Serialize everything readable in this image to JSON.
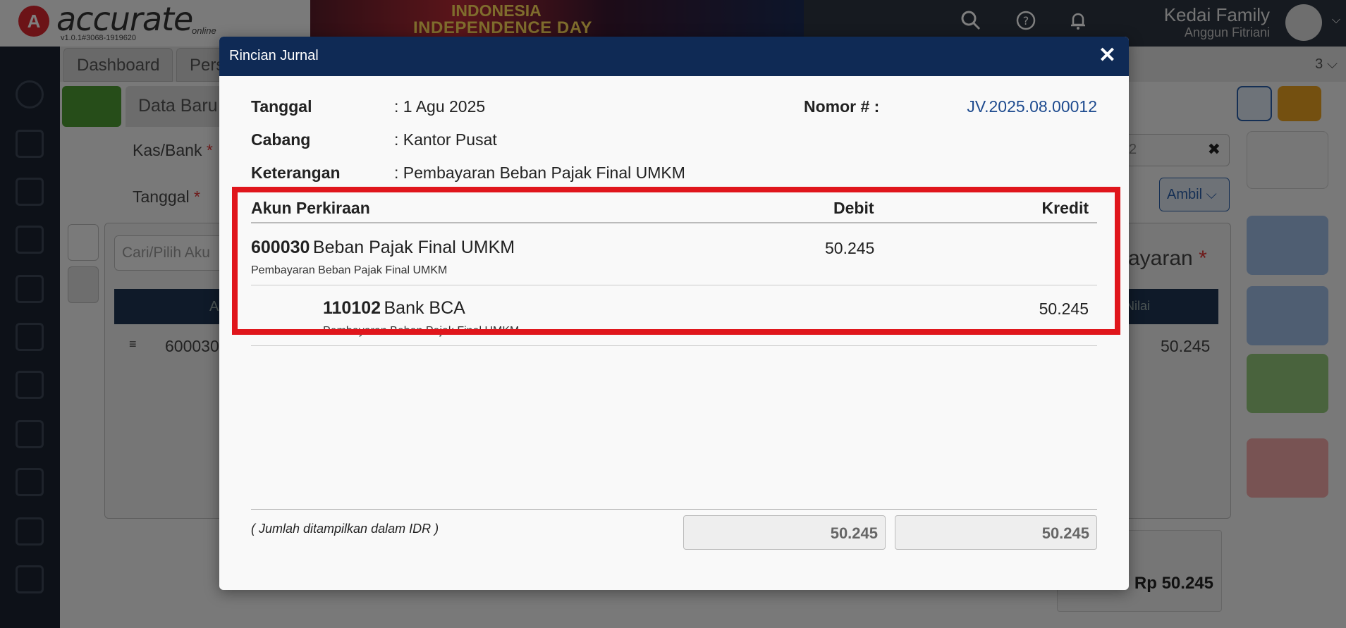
{
  "app": {
    "logo_text": "accurate",
    "logo_sub": "online",
    "version": "v1.0.1#3068-1919620",
    "banner_line1": "INDONESIA",
    "banner_line2": "INDEPENDENCE DAY",
    "company": "Kedai Family",
    "user": "Anggun Fitriani",
    "tabs": [
      "Dashboard",
      "Pers"
    ],
    "tab_count": "3 ⌵",
    "subtab": "Data Baru",
    "form_kas_bank": "Kas/Bank",
    "form_tanggal": "Tanggal",
    "search_placeholder": "Cari/Pilih Aku",
    "row_code": "600030",
    "col_a": "A",
    "col_nilai": "Nilai",
    "row_value": "50.245",
    "ambil_label": "Ambil",
    "section_label": "ayaran",
    "total": "Rp 50.245",
    "fragment_2": "2"
  },
  "modal": {
    "title": "Rincian Jurnal",
    "close_icon": "✕",
    "tanggal_label": "Tanggal",
    "tanggal_value": ": 1 Agu 2025",
    "cabang_label": "Cabang",
    "cabang_value": ": Kantor Pusat",
    "keterangan_label": "Keterangan",
    "keterangan_value": ": Pembayaran Beban Pajak Final UMKM",
    "nomor_label": "Nomor # :",
    "nomor_value": "JV.2025.08.00012",
    "table": {
      "headers": {
        "akun": "Akun Perkiraan",
        "debit": "Debit",
        "kredit": "Kredit"
      },
      "rows": [
        {
          "code": "600030",
          "name": "Beban Pajak Final UMKM",
          "desc": "Pembayaran Beban Pajak Final UMKM",
          "debit": "50.245",
          "kredit": ""
        },
        {
          "code": "110102",
          "name": "Bank BCA",
          "desc": "Pembayaran Beban Pajak Final UMKM",
          "debit": "",
          "kredit": "50.245"
        }
      ]
    },
    "footer_note": "( Jumlah ditampilkan dalam IDR )",
    "total_debit": "50.245",
    "total_kredit": "50.245"
  },
  "colors": {
    "header": "#0f2a55",
    "highlight": "#e0161c",
    "link": "#1e4b8f"
  }
}
